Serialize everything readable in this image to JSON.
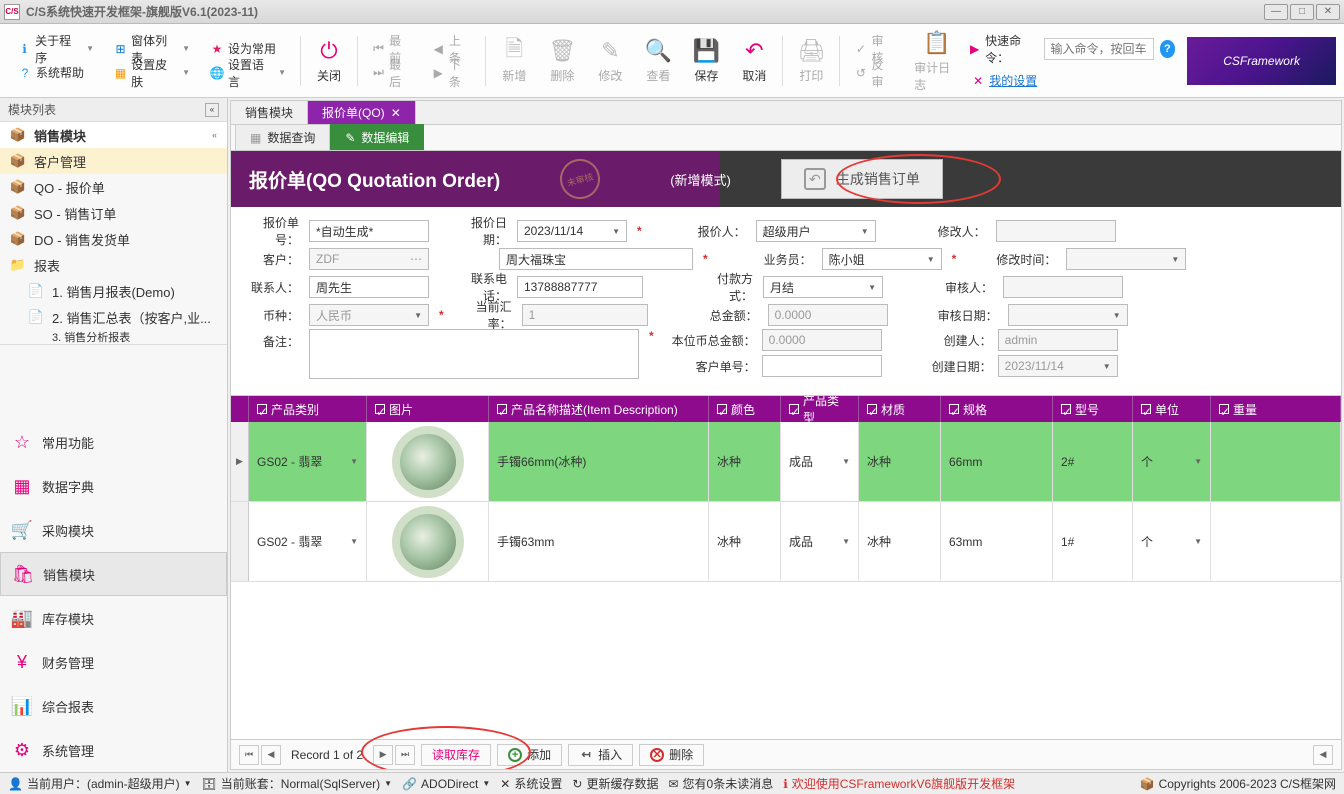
{
  "window": {
    "title": "C/S系统快速开发框架-旗舰版V6.1(2023-11)",
    "logo": "C/S"
  },
  "ribbon": {
    "left": [
      {
        "label": "关于程序",
        "caret": true,
        "color": "#2196f3"
      },
      {
        "label": "系统帮助",
        "caret": false,
        "color": "#2196f3"
      },
      {
        "label": "窗体列表",
        "caret": true,
        "color": "#9c27b0"
      },
      {
        "label": "设置皮肤",
        "caret": true,
        "color": "#ff9800"
      },
      {
        "label": "设为常用",
        "caret": false,
        "color": "#e91e63"
      },
      {
        "label": "设置语言",
        "caret": true,
        "color": "#4caf50"
      }
    ],
    "close": "关闭",
    "nav": [
      {
        "label": "最前",
        "dir": "⏮"
      },
      {
        "label": "上条",
        "dir": "◀"
      },
      {
        "label": "最后",
        "dir": "⏭"
      },
      {
        "label": "下条",
        "dir": "▶"
      }
    ],
    "actions": [
      {
        "label": "新增",
        "color": "#888"
      },
      {
        "label": "删除",
        "color": "#888"
      },
      {
        "label": "修改",
        "color": "#888"
      },
      {
        "label": "查看",
        "color": "#888"
      },
      {
        "label": "保存",
        "color": "#e6007e"
      },
      {
        "label": "取消",
        "color": "#e6007e"
      },
      {
        "label": "打印",
        "color": "#888"
      },
      {
        "label": "审核",
        "color": "#888"
      },
      {
        "label": "反审",
        "color": "#888"
      },
      {
        "label": "审计日志",
        "color": "#888"
      }
    ],
    "quick_label": "快速命令：",
    "quick_placeholder": "输入命令，按回车",
    "settings_link": "我的设置",
    "brand": "CSFramework"
  },
  "sidebar": {
    "header": "模块列表",
    "top_title": "销售模块",
    "items": [
      {
        "label": "客户管理",
        "active": true
      },
      {
        "label": "QO - 报价单",
        "active": false
      },
      {
        "label": "SO - 销售订单",
        "active": false
      },
      {
        "label": "DO - 销售发货单",
        "active": false
      },
      {
        "label": "报表",
        "active": false,
        "expandable": true
      },
      {
        "label": "1. 销售月报表(Demo)",
        "sub": true
      },
      {
        "label": "2. 销售汇总表（按客户,业...",
        "sub": true
      },
      {
        "label": "3. 销售分析报表",
        "sub": true,
        "cut": true
      }
    ],
    "modules": [
      {
        "label": "常用功能"
      },
      {
        "label": "数据字典"
      },
      {
        "label": "采购模块"
      },
      {
        "label": "销售模块",
        "active": true
      },
      {
        "label": "库存模块"
      },
      {
        "label": "财务管理"
      },
      {
        "label": "综合报表"
      },
      {
        "label": "系统管理"
      }
    ]
  },
  "main": {
    "tabs": [
      {
        "label": "销售模块"
      },
      {
        "label": "报价单(QO)",
        "active": true
      }
    ],
    "subtabs": [
      {
        "label": "数据查询"
      },
      {
        "label": "数据编辑",
        "active": true
      }
    ],
    "header_title": "报价单(QO Quotation Order)",
    "stamp": "未审核",
    "mode": "(新增模式)",
    "gen_button": "生成销售订单",
    "form": {
      "order_no_label": "报价单号：",
      "order_no": "*自动生成*",
      "date_label": "报价日期：",
      "date": "2023/11/14",
      "quoter_label": "报价人：",
      "quoter": "超级用户",
      "modifier_label": "修改人：",
      "modifier": "",
      "customer_label": "客户：",
      "customer_code": "ZDF",
      "customer_name": "周大福珠宝",
      "salesman_label": "业务员：",
      "salesman": "陈小姐",
      "modtime_label": "修改时间：",
      "modtime": "",
      "contact_label": "联系人：",
      "contact": "周先生",
      "phone_label": "联系电话：",
      "phone": "13788887777",
      "paymethod_label": "付款方式：",
      "paymethod": "月结",
      "auditor_label": "审核人：",
      "auditor": "",
      "currency_label": "币种：",
      "currency": "人民币",
      "rate_label": "当前汇率：",
      "rate": "1",
      "total_label": "总金额：",
      "total": "0.0000",
      "auditdate_label": "审核日期：",
      "auditdate": "",
      "remark_label": "备注：",
      "localtotal_label": "本位币总金额：",
      "localtotal": "0.0000",
      "creator_label": "创建人：",
      "creator": "admin",
      "custno_label": "客户单号：",
      "custno": "",
      "createdate_label": "创建日期：",
      "createdate": "2023/11/14"
    },
    "grid": {
      "cols": [
        "产品类别",
        "图片",
        "产品名称描述(Item Description)",
        "颜色",
        "产品类型",
        "材质",
        "规格",
        "型号",
        "单位",
        "重量"
      ],
      "rows": [
        {
          "cat": "GS02 - 翡翠",
          "desc": "手镯66mm(冰种)",
          "color": "冰种",
          "type": "成品",
          "mat": "冰种",
          "spec": "66mm",
          "model": "2#",
          "unit": "个",
          "sel": true
        },
        {
          "cat": "GS02 - 翡翠",
          "desc": "手镯63mm",
          "color": "冰种",
          "type": "成品",
          "mat": "冰种",
          "spec": "63mm",
          "model": "1#",
          "unit": "个",
          "sel": false
        }
      ],
      "record_info": "Record 1 of 2",
      "foot_buttons": {
        "read": "读取库存",
        "add": "添加",
        "insert": "插入",
        "delete": "删除"
      }
    }
  },
  "status": {
    "user": "当前用户：(admin-超级用户)",
    "account": "当前账套：Normal(SqlServer)",
    "adodirect": "ADODirect",
    "sysconfig": "系统设置",
    "refresh": "更新缓存数据",
    "msg": "您有0条未读消息",
    "welcome": "欢迎使用CSFrameworkV6旗舰版开发框架",
    "copyright": "Copyrights 2006-2023 C/S框架网"
  }
}
